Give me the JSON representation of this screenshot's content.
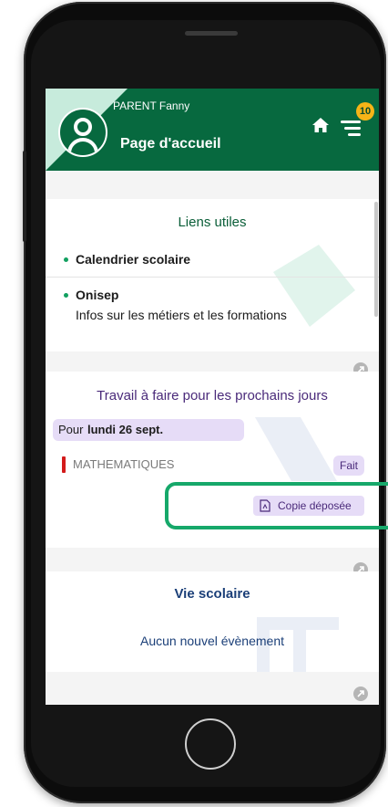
{
  "header": {
    "user_name": "PARENT Fanny",
    "page_title": "Page d'accueil",
    "notification_count": "10",
    "brand_color": "#07693f",
    "accent_color": "#f6b417"
  },
  "useful_links": {
    "title": "Liens utiles",
    "items": [
      {
        "label": "Calendrier scolaire",
        "description": ""
      },
      {
        "label": "Onisep",
        "description": "Infos sur les métiers et les formations"
      }
    ]
  },
  "homework": {
    "title": "Travail à faire pour les prochains jours",
    "date_prefix": "Pour",
    "date": "lundi 26 sept.",
    "subject": "MATHEMATIQUES",
    "status": "Fait",
    "copy_button": "Copie déposée"
  },
  "school_life": {
    "title": "Vie scolaire",
    "message": "Aucun nouvel évènement"
  },
  "icons": {
    "home": "home-icon",
    "menu": "menu-icon",
    "avatar": "user-avatar-icon",
    "external_link": "external-link-icon",
    "pdf": "pdf-icon"
  }
}
